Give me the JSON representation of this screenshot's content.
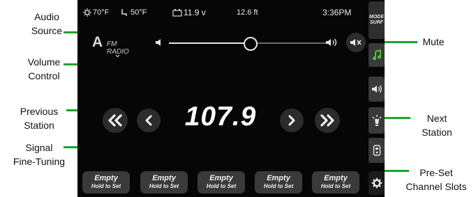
{
  "callouts": {
    "audio_source": [
      "Audio",
      "Source"
    ],
    "volume_control": [
      "Volume",
      "Control"
    ],
    "previous_station": [
      "Previous",
      "Station"
    ],
    "signal_fine_tuning": [
      "Signal",
      "Fine-Tuning"
    ],
    "mute": "Mute",
    "next_station": [
      "Next",
      "Station"
    ],
    "preset_slots": [
      "Pre-Set",
      "Channel Slots"
    ]
  },
  "status_bar": {
    "outside_temp": "70°F",
    "inside_temp": "50°F",
    "battery_voltage": "11.9 v",
    "trip_distance": "12.6 ft",
    "clock": "3:36PM"
  },
  "audio_source": {
    "label": "FM RADIO"
  },
  "volume": {
    "level_fraction": 0.52
  },
  "tuner": {
    "frequency": "107.9"
  },
  "presets": [
    {
      "line1": "Empty",
      "line2": "Hold to Set"
    },
    {
      "line1": "Empty",
      "line2": "Hold to Set"
    },
    {
      "line1": "Empty",
      "line2": "Hold to Set"
    },
    {
      "line1": "Empty",
      "line2": "Hold to Set"
    },
    {
      "line1": "Empty",
      "line2": "Hold to Set"
    }
  ],
  "side_rail": {
    "mode_line1": "MODE",
    "mode_line2": "SURF"
  },
  "colors": {
    "accent_green": "#19a62a",
    "music_icon_green": "#4fc23a",
    "screen_bg": "#060606"
  },
  "icons": [
    "thermometer-icon",
    "seat-icon",
    "battery-icon",
    "fm-antenna-icon",
    "chevron-down-icon",
    "volume-low-icon",
    "volume-high-icon",
    "mute-icon",
    "double-chevron-left-icon",
    "chevron-left-icon",
    "chevron-right-icon",
    "double-chevron-right-icon",
    "music-note-icon",
    "speaker-icon",
    "light-icon",
    "remote-icon",
    "gear-icon"
  ]
}
